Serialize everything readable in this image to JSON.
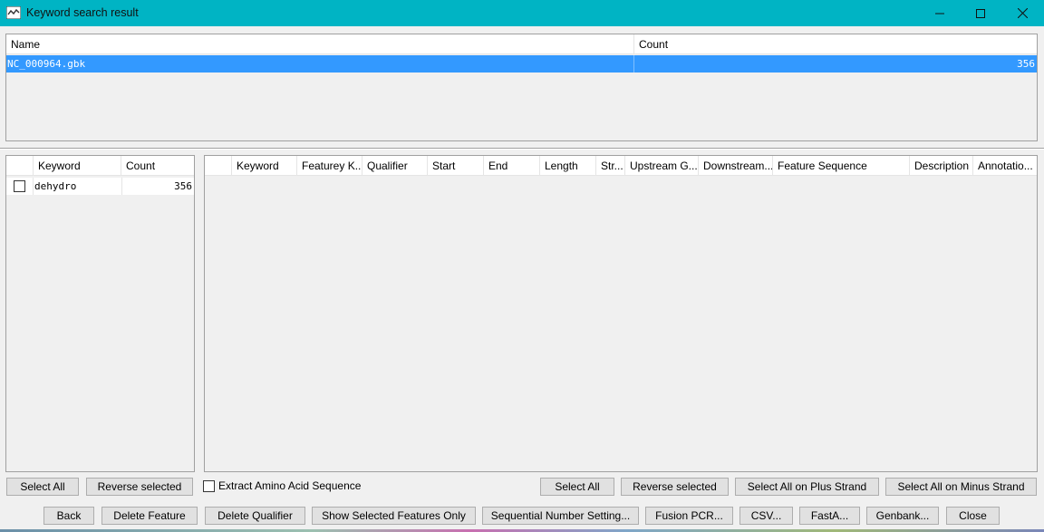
{
  "window": {
    "title": "Keyword search result",
    "icons": {
      "app": "app-logo-icon",
      "minimize": "minimize-icon",
      "maximize": "maximize-icon",
      "close": "close-icon"
    }
  },
  "files_table": {
    "columns": [
      "Name",
      "Count"
    ],
    "rows": [
      {
        "name": "NC_000964.gbk",
        "count": "356",
        "selected": true
      }
    ]
  },
  "keyword_table": {
    "columns": [
      "",
      "Keyword",
      "Count"
    ],
    "rows": [
      {
        "checked": false,
        "keyword": "dehydro",
        "count": "356"
      }
    ]
  },
  "feature_table": {
    "columns": [
      "",
      "Keyword",
      "Featurey K...",
      "Qualifier",
      "Start",
      "End",
      "Length",
      "Str...",
      "Upstream G...",
      "Downstream...",
      "Feature Sequence",
      "Description",
      "Annotatio..."
    ]
  },
  "left_actions": {
    "select_all": "Select All",
    "reverse_selected": "Reverse selected"
  },
  "extract_amino": {
    "label": "Extract Amino Acid Sequence",
    "checked": false
  },
  "right_actions": {
    "select_all": "Select All",
    "reverse_selected": "Reverse selected",
    "select_plus": "Select All on Plus Strand",
    "select_minus": "Select All on Minus Strand"
  },
  "bottom_actions": {
    "back": "Back",
    "delete_feature": "Delete Feature",
    "delete_qualifier": "Delete Qualifier",
    "show_selected": "Show Selected Features Only",
    "sequential_number": "Sequential Number Setting...",
    "fusion_pcr": "Fusion PCR...",
    "csv": "CSV...",
    "fasta": "FastA...",
    "genbank": "Genbank...",
    "close": "Close"
  }
}
